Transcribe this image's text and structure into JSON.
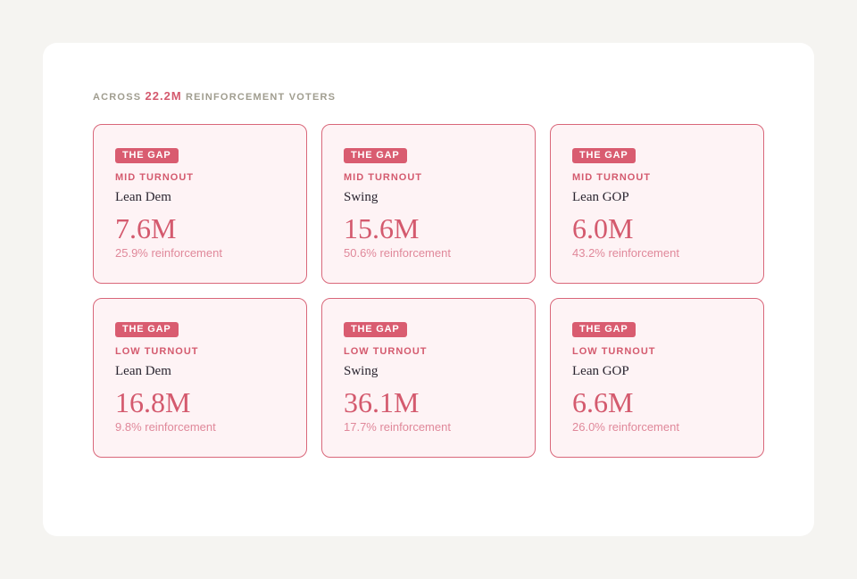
{
  "header": {
    "prefix": "ACROSS",
    "highlight": "22.2M",
    "suffix": "REINFORCEMENT VOTERS"
  },
  "cards": [
    {
      "badge": "THE GAP",
      "turnout": "MID TURNOUT",
      "lean": "Lean Dem",
      "value": "7.6M",
      "sub": "25.9% reinforcement"
    },
    {
      "badge": "THE GAP",
      "turnout": "MID TURNOUT",
      "lean": "Swing",
      "value": "15.6M",
      "sub": "50.6% reinforcement"
    },
    {
      "badge": "THE GAP",
      "turnout": "MID TURNOUT",
      "lean": "Lean GOP",
      "value": "6.0M",
      "sub": "43.2% reinforcement"
    },
    {
      "badge": "THE GAP",
      "turnout": "LOW TURNOUT",
      "lean": "Lean Dem",
      "value": "16.8M",
      "sub": "9.8% reinforcement"
    },
    {
      "badge": "THE GAP",
      "turnout": "LOW TURNOUT",
      "lean": "Swing",
      "value": "36.1M",
      "sub": "17.7% reinforcement"
    },
    {
      "badge": "THE GAP",
      "turnout": "LOW TURNOUT",
      "lean": "Lean GOP",
      "value": "6.6M",
      "sub": "26.0% reinforcement"
    }
  ],
  "colors": {
    "accent": "#d45a6e",
    "badge_bg": "#d95c70",
    "card_bg": "#fef3f5",
    "card_border": "#d9677a",
    "muted_text": "#a09d8f",
    "page_bg": "#f5f4f1"
  }
}
